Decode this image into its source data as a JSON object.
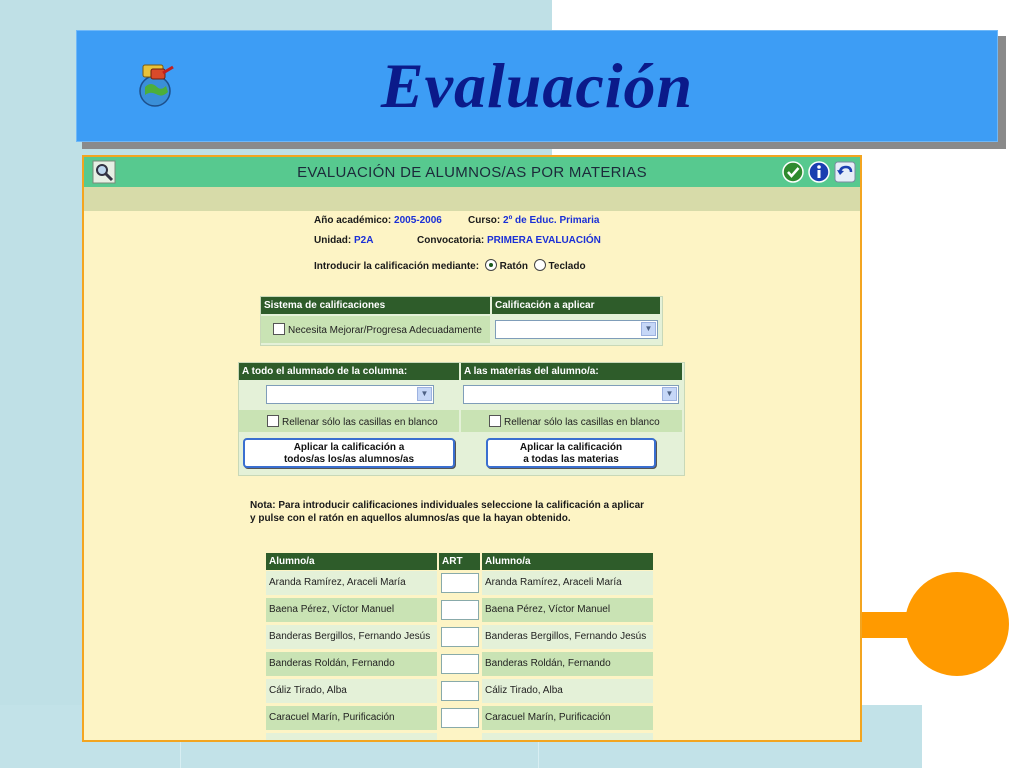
{
  "slide": {
    "title": "Evaluación",
    "colors": {
      "banner": "#3d9df5",
      "title_text": "#0b1a8a",
      "accent_orange": "#ff9a00"
    }
  },
  "app": {
    "title": "EVALUACIÓN DE ALUMNOS/AS POR MATERIAS",
    "header_icons": [
      "magnifier-icon",
      "accept-icon",
      "info-icon",
      "undo-icon"
    ],
    "info": {
      "year_label": "Año académico:",
      "year_value": "2005-2006",
      "course_label": "Curso:",
      "course_value": "2º de Educ. Primaria",
      "unit_label": "Unidad:",
      "unit_value": "P2A",
      "call_label": "Convocatoria:",
      "call_value": "PRIMERA EVALUACIÓN",
      "input_label": "Introducir la calificación mediante:",
      "radio_mouse": "Ratón",
      "radio_keyboard": "Teclado",
      "selected": "Ratón"
    },
    "grading": {
      "system_header": "Sistema de calificaciones",
      "apply_header": "Calificación a aplicar",
      "system_option": "Necesita Mejorar/Progresa Adecuadamente",
      "apply_value": ""
    },
    "bulk": {
      "column_header": "A todo el alumnado de la columna:",
      "student_header": "A las materias del alumno/a:",
      "column_select": "",
      "student_select": "",
      "fill_blank_left": "Rellenar sólo las casillas en blanco",
      "fill_blank_right": "Rellenar sólo las casillas en blanco",
      "apply_all_line1": "Aplicar la calificación a",
      "apply_all_line2": "todos/as los/as alumnos/as",
      "apply_subjects_line1": "Aplicar la calificación",
      "apply_subjects_line2": "a todas las materias"
    },
    "note": {
      "line1": "Nota: Para introducir calificaciones individuales seleccione la calificación a aplicar",
      "line2": "y pulse con el ratón en aquellos alumnos/as que la hayan obtenido."
    },
    "students_table": {
      "headers": [
        "Alumno/a",
        "ART",
        "Alumno/a"
      ],
      "rows": [
        {
          "name": "Aranda Ramírez, Araceli María",
          "art": ""
        },
        {
          "name": "Baena Pérez, Víctor Manuel",
          "art": ""
        },
        {
          "name": "Banderas Bergillos, Fernando Jesús",
          "art": ""
        },
        {
          "name": "Banderas Roldán, Fernando",
          "art": ""
        },
        {
          "name": "Cáliz Tirado, Alba",
          "art": ""
        },
        {
          "name": "Caracuel Marín, Purificación",
          "art": ""
        }
      ]
    }
  }
}
